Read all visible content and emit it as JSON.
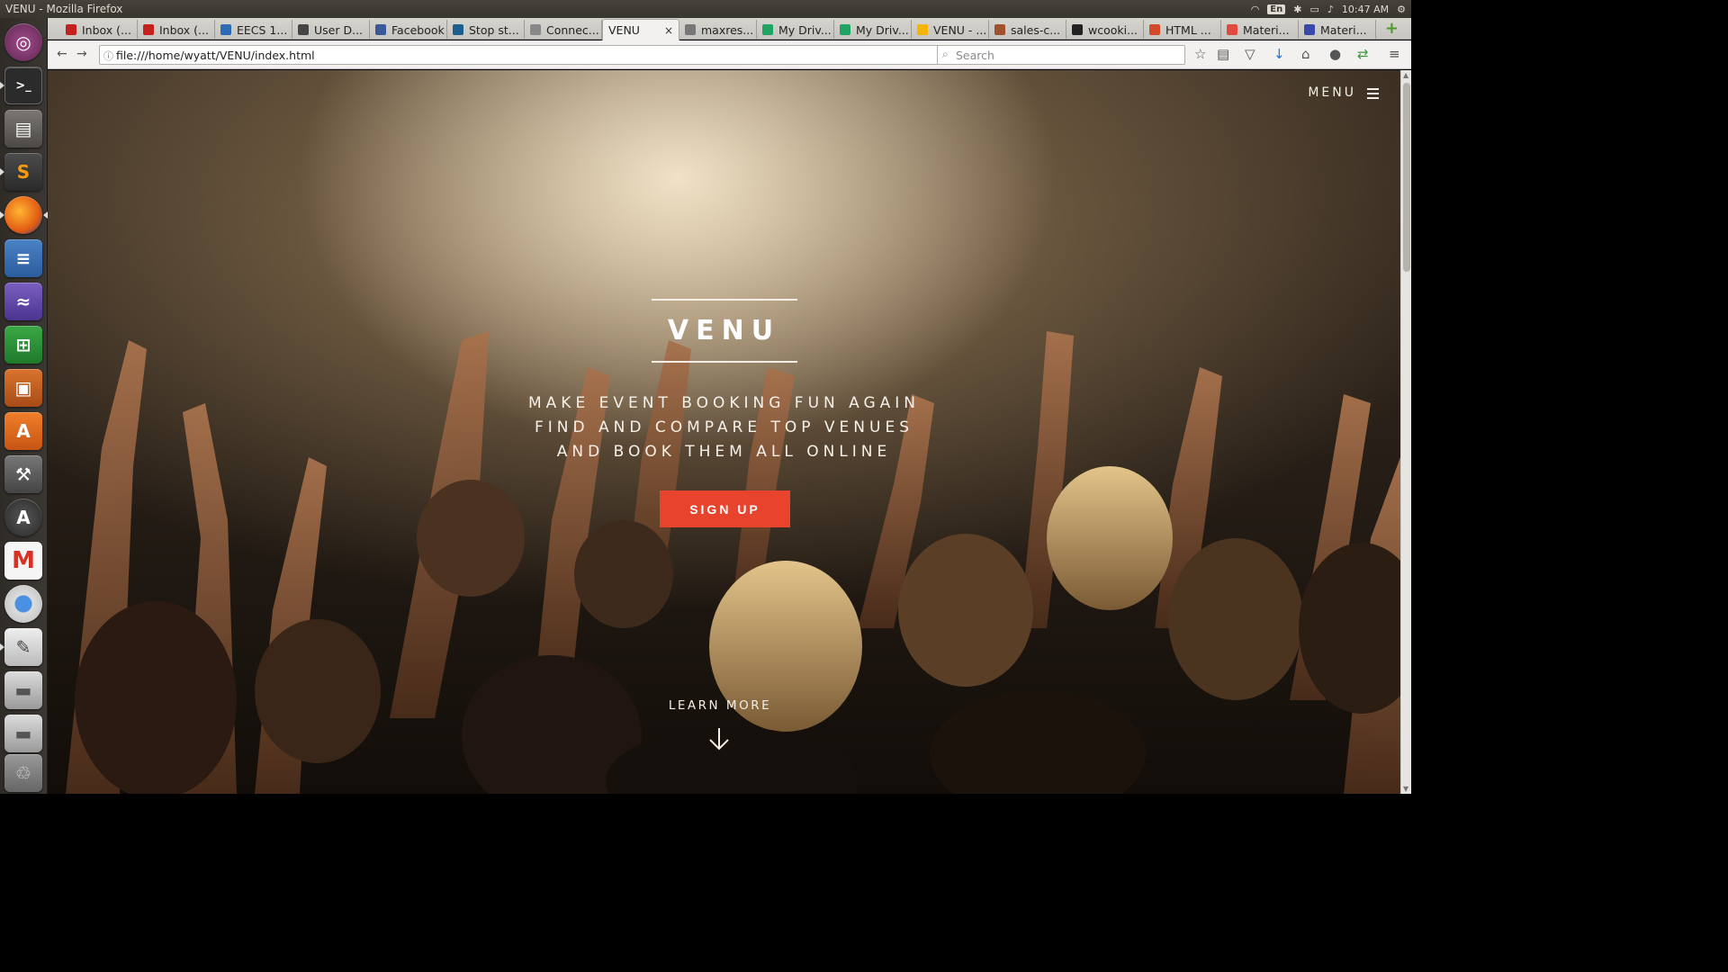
{
  "system": {
    "window_title": "VENU - Mozilla Firefox",
    "keyboard_layout": "En",
    "clock": "10:47 AM"
  },
  "launcher": {
    "items": [
      "ubuntu-dash-icon",
      "terminal-icon",
      "files-icon",
      "sublime-text-icon",
      "firefox-icon",
      "writer-icon",
      "emacs-icon",
      "calc-icon",
      "impress-icon",
      "software-center-icon",
      "settings-icon",
      "updater-icon",
      "gmail-icon",
      "chromium-icon",
      "text-editor-icon",
      "drive-icon",
      "drive2-icon",
      "trash-icon"
    ]
  },
  "tabs": [
    {
      "label": "Inbox (...",
      "fav_color": "#c5221f"
    },
    {
      "label": "Inbox (...",
      "fav_color": "#c5221f"
    },
    {
      "label": "EECS 1...",
      "fav_color": "#2d6bb5"
    },
    {
      "label": "User D...",
      "fav_color": "#444444"
    },
    {
      "label": "Facebook",
      "fav_color": "#3b5998"
    },
    {
      "label": "Stop st...",
      "fav_color": "#1c5f8c"
    },
    {
      "label": "Connec...",
      "fav_color": "#888888"
    },
    {
      "label": "VENU",
      "fav_color": "",
      "active": true
    },
    {
      "label": "maxres...",
      "fav_color": "#777777"
    },
    {
      "label": "My Driv...",
      "fav_color": "#1fa463"
    },
    {
      "label": "My Driv...",
      "fav_color": "#1fa463"
    },
    {
      "label": "VENU - ...",
      "fav_color": "#f4b400"
    },
    {
      "label": "sales-c...",
      "fav_color": "#a0522d"
    },
    {
      "label": "wcooki...",
      "fav_color": "#222222"
    },
    {
      "label": "HTML ...",
      "fav_color": "#d24a29"
    },
    {
      "label": "Materi...",
      "fav_color": "#e04a3f"
    },
    {
      "label": "Materi...",
      "fav_color": "#3949ab"
    }
  ],
  "navigation": {
    "url": "file:///home/wyatt/VENU/index.html",
    "search_placeholder": "Search"
  },
  "page": {
    "menu_label": "MENU",
    "brand": "VENU",
    "tagline": [
      "MAKE EVENT BOOKING FUN AGAIN",
      "FIND AND COMPARE TOP VENUES",
      "AND BOOK THEM ALL ONLINE"
    ],
    "signup_label": "SIGN UP",
    "learn_more_label": "LEARN MORE",
    "accent_color": "#e8432d"
  }
}
